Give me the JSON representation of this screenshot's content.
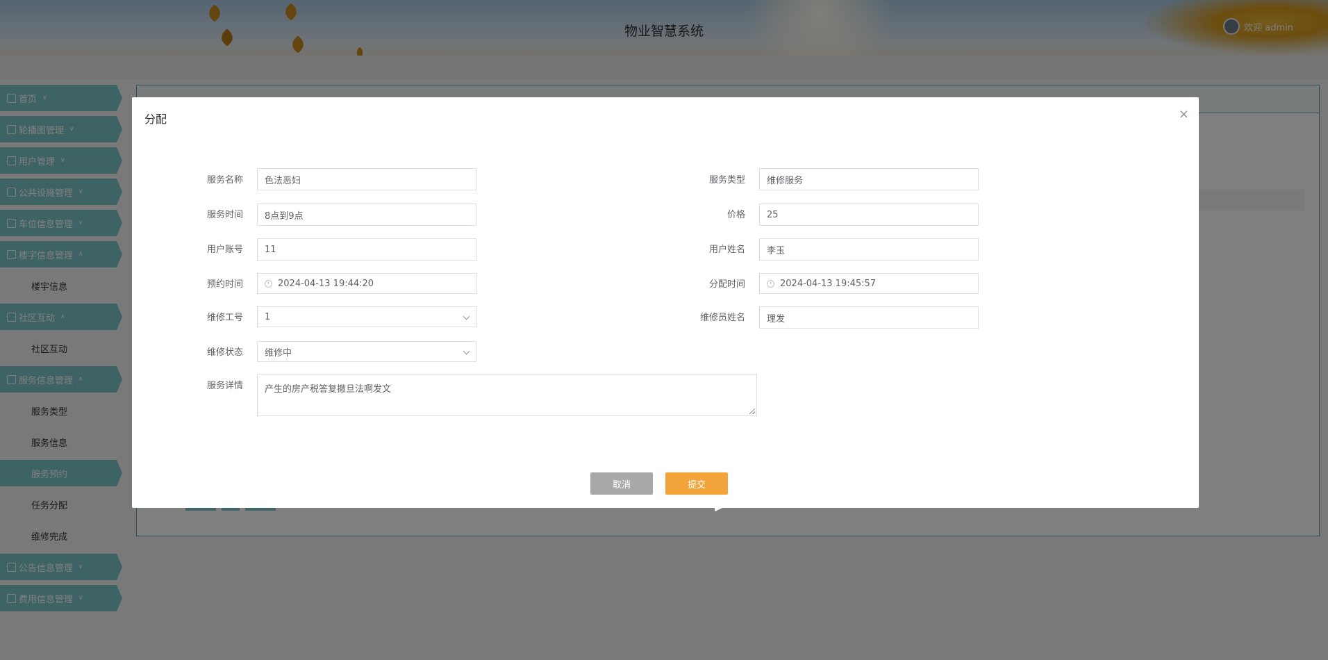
{
  "header": {
    "title": "物业智慧系统",
    "welcome": "欢迎 admin"
  },
  "sidebar": {
    "items": [
      {
        "label": "首页",
        "icon": "home-icon"
      },
      {
        "label": "轮播图管理",
        "icon": "image-icon"
      },
      {
        "label": "用户管理",
        "icon": "user-icon"
      },
      {
        "label": "公共设施管理",
        "icon": "facility-icon"
      },
      {
        "label": "车位信息管理",
        "icon": "car-icon"
      },
      {
        "label": "楼宇信息管理",
        "icon": "building-icon",
        "children": [
          "楼宇信息"
        ]
      },
      {
        "label": "社区互动",
        "icon": "community-icon",
        "children": [
          "社区互动"
        ]
      },
      {
        "label": "服务信息管理",
        "icon": "service-icon",
        "children": [
          "服务类型",
          "服务信息",
          "服务预约",
          "任务分配",
          "维修完成"
        ]
      },
      {
        "label": "公告信息管理",
        "icon": "notice-icon"
      },
      {
        "label": "费用信息管理",
        "icon": "fee-icon"
      }
    ],
    "active_sub": "服务预约"
  },
  "dialog": {
    "title": "分配",
    "close_glyph": "×",
    "fields": {
      "service_name": {
        "label": "服务名称",
        "value": "色法恶妇"
      },
      "service_type": {
        "label": "服务类型",
        "value": "维修服务"
      },
      "service_time": {
        "label": "服务时间",
        "value": "8点到9点"
      },
      "price": {
        "label": "价格",
        "value": "25"
      },
      "user_account": {
        "label": "用户账号",
        "value": "11"
      },
      "user_name": {
        "label": "用户姓名",
        "value": "李玉"
      },
      "booking_time": {
        "label": "预约时间",
        "value": "2024-04-13 19:44:20"
      },
      "assign_time": {
        "label": "分配时间",
        "value": "2024-04-13 19:45:57"
      },
      "worker_id": {
        "label": "维修工号",
        "value": "1"
      },
      "worker_name": {
        "label": "维修员姓名",
        "value": "理发"
      },
      "repair_status": {
        "label": "维修状态",
        "value": "维修中"
      },
      "service_detail": {
        "label": "服务详情",
        "value": "产生的房产税答复撤旦法啊发文"
      }
    },
    "buttons": {
      "cancel": "取消",
      "submit": "提交"
    }
  },
  "colors": {
    "menu": "#7cc7c9",
    "submit": "#f2a43a",
    "cancel": "#a8a8a8"
  }
}
